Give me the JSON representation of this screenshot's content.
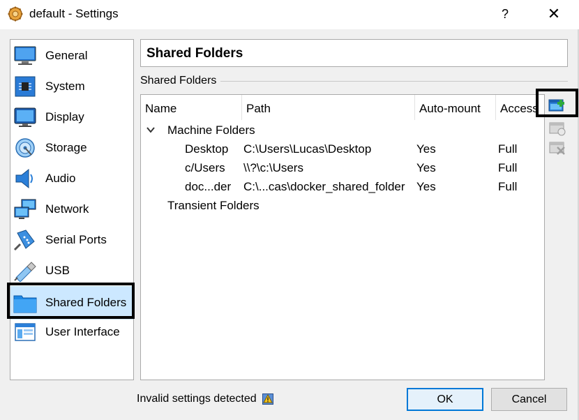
{
  "window": {
    "title": "default - Settings",
    "help_label": "?",
    "close_label": "✕"
  },
  "sidebar": {
    "items": [
      {
        "label": "General",
        "icon": "general-icon"
      },
      {
        "label": "System",
        "icon": "system-icon"
      },
      {
        "label": "Display",
        "icon": "display-icon"
      },
      {
        "label": "Storage",
        "icon": "storage-icon"
      },
      {
        "label": "Audio",
        "icon": "audio-icon"
      },
      {
        "label": "Network",
        "icon": "network-icon"
      },
      {
        "label": "Serial Ports",
        "icon": "serial-ports-icon"
      },
      {
        "label": "USB",
        "icon": "usb-icon"
      },
      {
        "label": "Shared Folders",
        "icon": "shared-folders-icon",
        "selected": true
      },
      {
        "label": "User Interface",
        "icon": "user-interface-icon"
      }
    ]
  },
  "page": {
    "title": "Shared Folders",
    "group_label": "Shared Folders"
  },
  "table": {
    "columns": [
      "Name",
      "Path",
      "Auto-mount",
      "Access"
    ],
    "machine_group": "Machine Folders",
    "transient_group": "Transient Folders",
    "rows": [
      {
        "name": "Desktop",
        "path": "C:\\Users\\Lucas\\Desktop",
        "automount": "Yes",
        "access": "Full"
      },
      {
        "name": "c/Users",
        "path": "\\\\?\\c:\\Users",
        "automount": "Yes",
        "access": "Full"
      },
      {
        "name": "doc...der",
        "path": "C:\\...cas\\docker_shared_folder",
        "automount": "Yes",
        "access": "Full"
      }
    ]
  },
  "toolbar": {
    "add_icon": "add-shared-folder-icon",
    "edit_icon": "edit-shared-folder-icon",
    "remove_icon": "remove-shared-folder-icon"
  },
  "footer": {
    "status": "Invalid settings detected",
    "ok_label": "OK",
    "cancel_label": "Cancel"
  },
  "colors": {
    "selection": "#cce8ff",
    "ok_border": "#0078d7",
    "icon_blue": "#1e88e5"
  }
}
